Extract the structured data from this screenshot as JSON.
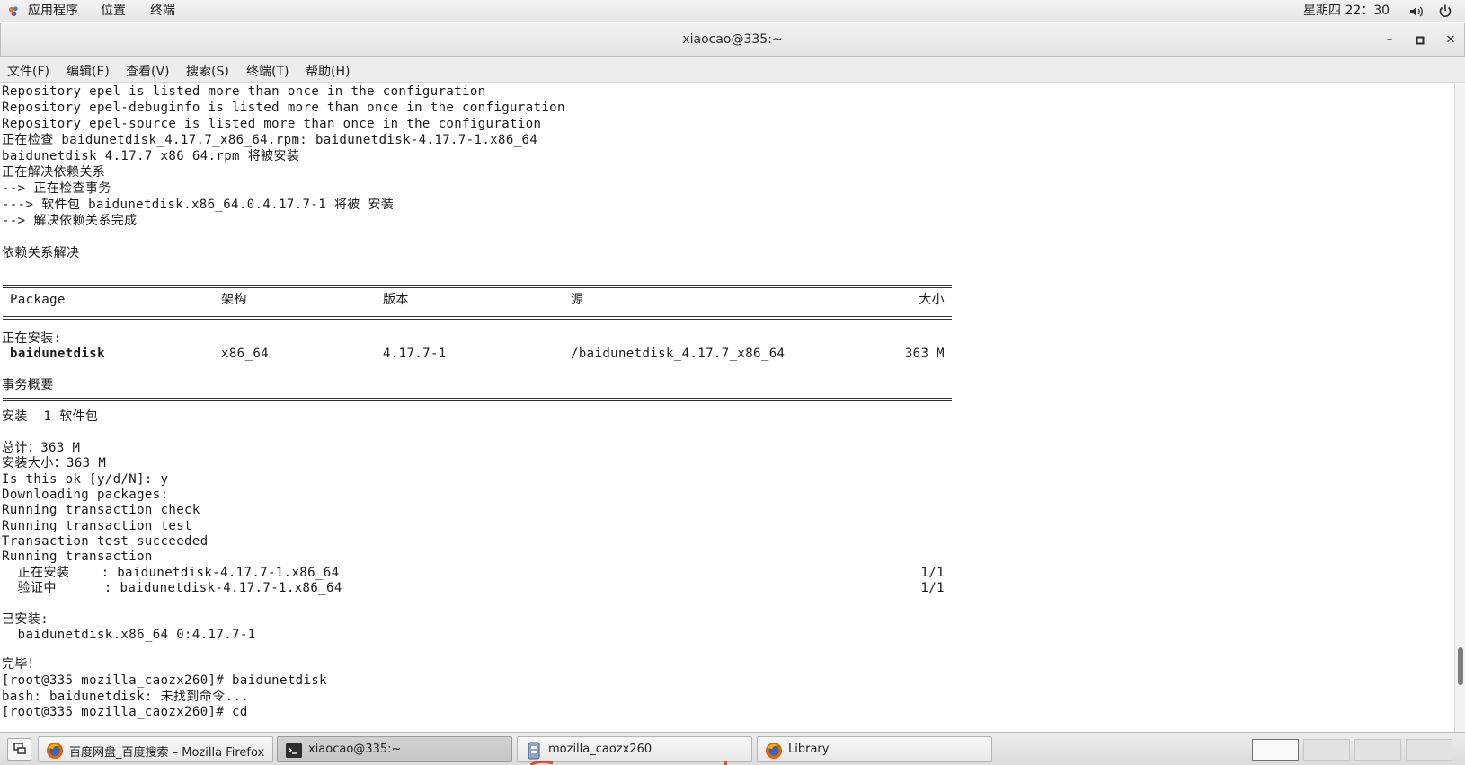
{
  "topbar": {
    "applications": "应用程序",
    "places": "位置",
    "terminal": "终端",
    "clock": "星期四 22：30",
    "icons": [
      "apps-icon",
      "volume-icon",
      "power-icon"
    ]
  },
  "window": {
    "title": "xiaocao@335:~",
    "controls": [
      "minimize-icon",
      "maximize-icon",
      "close-icon"
    ]
  },
  "menubar": {
    "items": [
      "文件(F)",
      "编辑(E)",
      "查看(V)",
      "搜索(S)",
      "终端(T)",
      "帮助(H)"
    ]
  },
  "terminal": {
    "lines_top": [
      "Repository epel is listed more than once in the configuration",
      "Repository epel-debuginfo is listed more than once in the configuration",
      "Repository epel-source is listed more than once in the configuration",
      "正在检查 baidunetdisk_4.17.7_x86_64.rpm: baidunetdisk-4.17.7-1.x86_64",
      "baidunetdisk_4.17.7_x86_64.rpm 将被安装",
      "正在解决依赖关系",
      "--> 正在检查事务",
      "---> 软件包 baidunetdisk.x86_64.0.4.17.7-1 将被 安装",
      "--> 解决依赖关系完成",
      "",
      "依赖关系解决"
    ],
    "table_header": {
      "package": "Package",
      "arch": "架构",
      "version": "版本",
      "repo": "源",
      "size": "大小"
    },
    "installing_label": "正在安装:",
    "package_row": {
      "name": "baidunetdisk",
      "arch": "x86_64",
      "version": "4.17.7-1",
      "repo": "/baidunetdisk_4.17.7_x86_64",
      "size": "363 M"
    },
    "summary_label": "事务概要",
    "lines_bottom": [
      "安装  1 软件包",
      "",
      "总计：363 M",
      "安装大小：363 M",
      "Is this ok [y/d/N]: y",
      "Downloading packages:",
      "Running transaction check",
      "Running transaction test",
      "Transaction test succeeded",
      "Running transaction"
    ],
    "progress": [
      {
        "action": "  正在安装    : baidunetdisk-4.17.7-1.x86_64",
        "count": "1/1"
      },
      {
        "action": "  验证中      : baidunetdisk-4.17.7-1.x86_64",
        "count": "1/1"
      }
    ],
    "lines_end": [
      "",
      "已安装:",
      "  baidunetdisk.x86_64 0:4.17.7-1",
      "",
      "完毕！",
      "[root@335 mozilla_caozx260]# baidunetdisk",
      "bash: baidunetdisk: 未找到命令...",
      "[root@335 mozilla_caozx260]# cd"
    ]
  },
  "taskbar": {
    "tasks": [
      {
        "label": "百度网盘_百度搜索 – Mozilla Firefox",
        "icon": "firefox-icon"
      },
      {
        "label": "xiaocao@335:~",
        "icon": "terminal-icon"
      },
      {
        "label": "mozilla_caozx260",
        "icon": "file-manager-icon"
      },
      {
        "label": "Library",
        "icon": "firefox-icon"
      }
    ],
    "workspaces": 4,
    "active_workspace": 1
  },
  "colors": {
    "terminal_bg": "#ffffff",
    "terminal_fg": "#1a1a1a",
    "bar_bg": "#e8e8e8"
  }
}
